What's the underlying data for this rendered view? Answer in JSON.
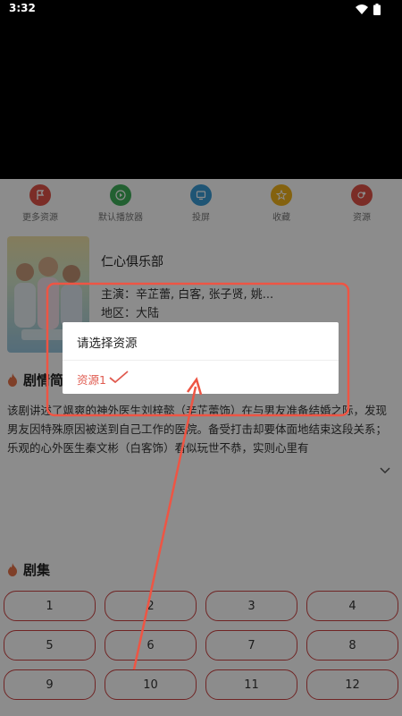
{
  "status_bar": {
    "time": "3:32"
  },
  "actions": [
    {
      "label": "更多资源",
      "icon": "flag-icon",
      "color": "#e05247"
    },
    {
      "label": "默认播放器",
      "icon": "play-icon",
      "color": "#3fb05a"
    },
    {
      "label": "投屏",
      "icon": "cast-icon",
      "color": "#3a9bd6"
    },
    {
      "label": "收藏",
      "icon": "star-icon",
      "color": "#f1b31c"
    },
    {
      "label": "资源",
      "icon": "resource-icon",
      "color": "#e05247"
    }
  ],
  "show": {
    "title": "仁心俱乐部",
    "cast": "主演：辛芷蕾, 白客, 张子贤, 姚...",
    "region": "地区：大陆"
  },
  "synopsis": {
    "heading": "剧情简介",
    "text": "该剧讲述了飒爽的神外医生刘梓懿（辛芷蕾饰）在与男友准备结婚之际，发现男友因特殊原因被送到自己工作的医院。备受打击却要体面地结束这段关系；乐观的心外医生秦文彬（白客饰）看似玩世不恭，实则心里有"
  },
  "episodes": {
    "heading": "剧集",
    "items": [
      "1",
      "2",
      "3",
      "4",
      "5",
      "6",
      "7",
      "8",
      "9",
      "10",
      "11",
      "12"
    ]
  },
  "dialog": {
    "title": "请选择资源",
    "option": "资源1"
  },
  "colors": {
    "accent": "#e05a4f",
    "annotation": "#ee5544"
  }
}
